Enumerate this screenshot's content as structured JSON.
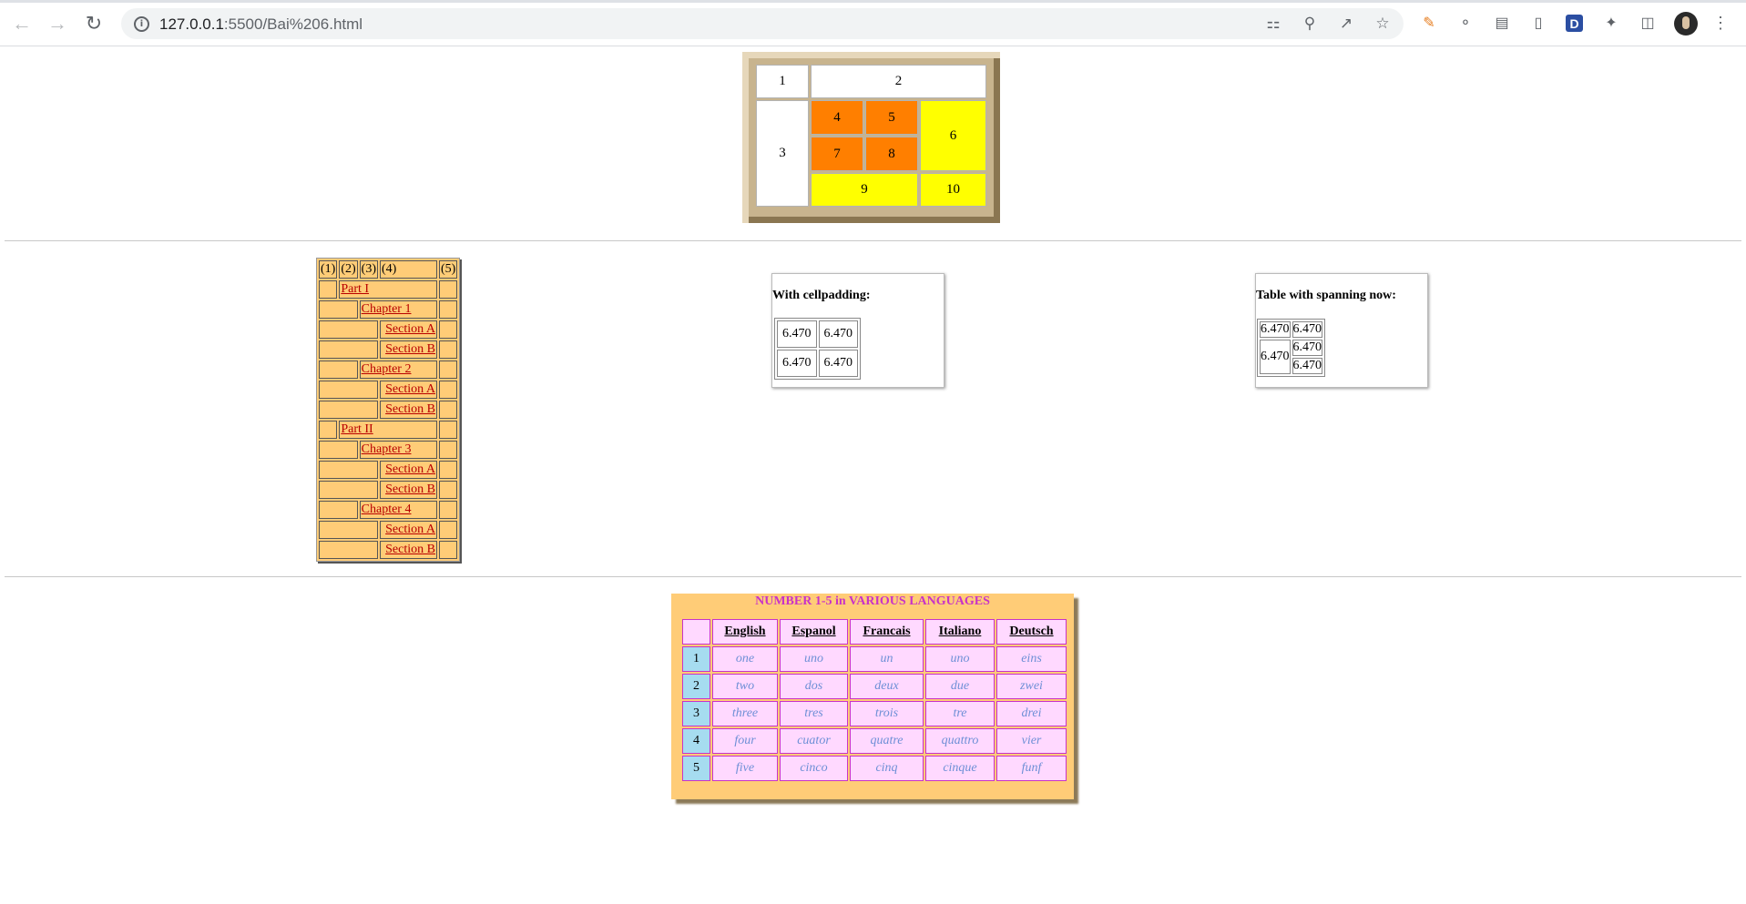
{
  "browser": {
    "url_host": "127.0.0.1",
    "url_rest": ":5500/Bai%206.html",
    "icons": {
      "back": "back-arrow-icon",
      "forward": "forward-arrow-icon",
      "reload": "reload-icon",
      "info": "info-icon",
      "translate": "translate-icon",
      "zoom": "zoom-out-icon",
      "share": "share-icon",
      "bookmark": "star-icon",
      "extensions": "puzzle-icon",
      "sidepanel": "side-panel-icon",
      "menu": "kebab-menu-icon"
    },
    "extension_d_label": "D"
  },
  "table1": {
    "cells": [
      "1",
      "2",
      "3",
      "4",
      "5",
      "6",
      "7",
      "8",
      "9",
      "10"
    ],
    "colors": {
      "white": "#ffffff",
      "orange": "#ff7f00",
      "yellow": "#ffff00",
      "frame": "#c8b48e"
    }
  },
  "toc": {
    "headers": [
      "(1)",
      "(2)",
      "(3)",
      "(4)",
      "(5)"
    ],
    "rows": [
      {
        "indent": 1,
        "label": "Part I"
      },
      {
        "indent": 2,
        "label": "Chapter 1"
      },
      {
        "indent": 3,
        "label": "Section A"
      },
      {
        "indent": 3,
        "label": "Section B"
      },
      {
        "indent": 2,
        "label": "Chapter 2"
      },
      {
        "indent": 3,
        "label": "Section A"
      },
      {
        "indent": 3,
        "label": "Section B"
      },
      {
        "indent": 1,
        "label": "Part II"
      },
      {
        "indent": 2,
        "label": "Chapter 3"
      },
      {
        "indent": 3,
        "label": "Section A"
      },
      {
        "indent": 3,
        "label": "Section B"
      },
      {
        "indent": 2,
        "label": "Chapter 4"
      },
      {
        "indent": 3,
        "label": "Section A"
      },
      {
        "indent": 3,
        "label": "Section B"
      }
    ],
    "colors": {
      "background": "#ffcc77",
      "link": "#b80000"
    }
  },
  "cellpadding_box": {
    "title": "With cellpadding:",
    "values": [
      "6.470",
      "6.470",
      "6.470",
      "6.470"
    ]
  },
  "spanning_box": {
    "title": "Table with spanning now:",
    "values": [
      "6.470",
      "6.470",
      "6.470",
      "6.470",
      "6.470"
    ]
  },
  "languages": {
    "caption": "NUMBER 1-5 in VARIOUS LANGUAGES",
    "headers": [
      "English",
      "Espanol",
      "Francais",
      "Italiano",
      "Deutsch"
    ],
    "rows": [
      {
        "num": "1",
        "words": [
          "one",
          "uno",
          "un",
          "uno",
          "eins"
        ]
      },
      {
        "num": "2",
        "words": [
          "two",
          "dos",
          "deux",
          "due",
          "zwei"
        ]
      },
      {
        "num": "3",
        "words": [
          "three",
          "tres",
          "trois",
          "tre",
          "drei"
        ]
      },
      {
        "num": "4",
        "words": [
          "four",
          "cuator",
          "quatre",
          "quattro",
          "vier"
        ]
      },
      {
        "num": "5",
        "words": [
          "five",
          "cinco",
          "cinq",
          "cinque",
          "funf"
        ]
      }
    ],
    "colors": {
      "background": "#ffcc77",
      "cell": "#ffd9ff",
      "number_cell": "#a6dcf0",
      "border": "#c832c8",
      "word": "#6d8fd6",
      "caption": "#c832c8"
    }
  }
}
